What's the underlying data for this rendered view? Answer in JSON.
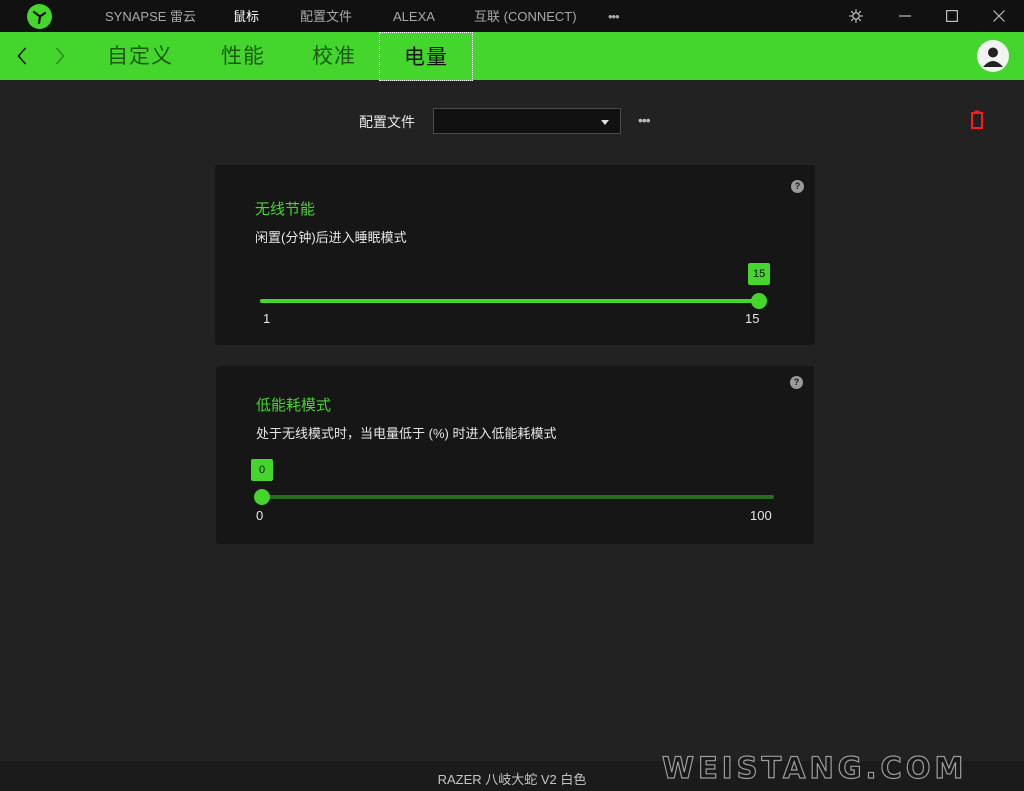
{
  "topnav": {
    "items": [
      {
        "label": "SYNAPSE 雷云"
      },
      {
        "label": "鼠标"
      },
      {
        "label": "配置文件"
      },
      {
        "label": "ALEXA"
      },
      {
        "label": "互联 (CONNECT)"
      }
    ],
    "more": "•••",
    "active_index": 1
  },
  "icons": {
    "logo": "razer-logo-icon",
    "settings": "gear-icon",
    "minimize": "minimize-icon",
    "maximize": "maximize-icon",
    "close": "close-icon",
    "back": "chevron-left-icon",
    "forward": "chevron-right-icon",
    "avatar": "user-avatar-icon",
    "battery": "battery-empty-icon",
    "help": "help-icon"
  },
  "subnav": {
    "tabs": [
      {
        "label": "自定义"
      },
      {
        "label": "性能"
      },
      {
        "label": "校准"
      },
      {
        "label": "电量"
      }
    ],
    "active_index": 3
  },
  "profile": {
    "label": "配置文件",
    "selected": "",
    "more": "•••"
  },
  "wireless_power_saving": {
    "title": "无线节能",
    "description": "闲置(分钟)后进入睡眠模式",
    "help": "?",
    "min": 1,
    "max": 15,
    "value": 15,
    "value_label": "15",
    "min_label": "1",
    "max_label": "15"
  },
  "low_power_mode": {
    "title": "低能耗模式",
    "description": "处于无线模式时，当电量低于 (%) 时进入低能耗模式",
    "help": "?",
    "min": 0,
    "max": 100,
    "value": 0,
    "value_label": "0",
    "min_label": "0",
    "max_label": "100"
  },
  "footer": {
    "device_name": "RAZER 八岐大蛇 V2 白色"
  },
  "watermark": "WEISTANG.COM",
  "colors": {
    "accent": "#44d62c",
    "background": "#222222",
    "card": "#161616",
    "titlebar": "#111111",
    "battery_low": "#ff1a1a"
  }
}
